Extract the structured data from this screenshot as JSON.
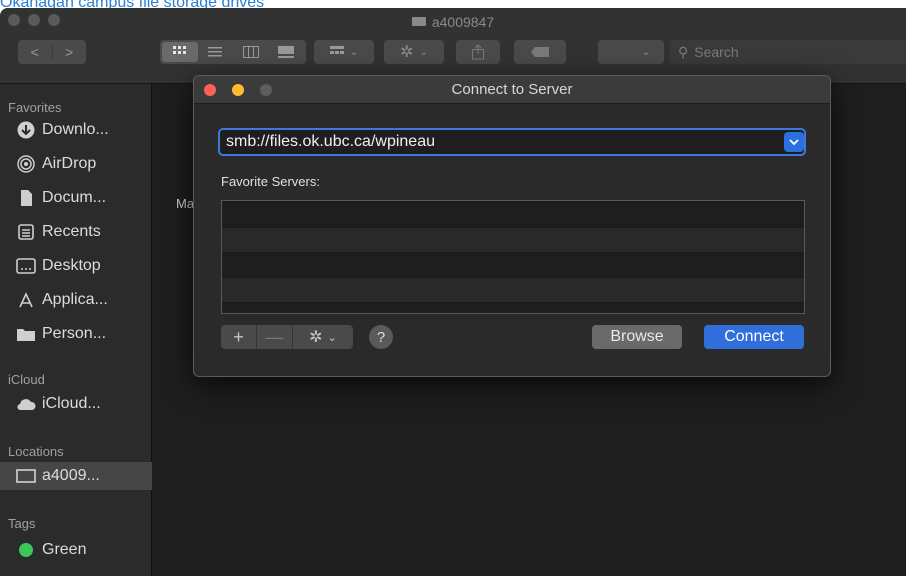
{
  "page_link": "Okanagan campus file storage drives",
  "window": {
    "title": "a4009847"
  },
  "toolbar": {
    "back": "<",
    "forward": ">",
    "search_placeholder": "Search"
  },
  "sidebar": {
    "sections": {
      "favorites": "Favorites",
      "icloud": "iCloud",
      "locations": "Locations",
      "tags": "Tags"
    },
    "favorites": [
      {
        "label": "Downlo...",
        "icon": "download-icon"
      },
      {
        "label": "AirDrop",
        "icon": "airdrop-icon"
      },
      {
        "label": "Docum...",
        "icon": "document-icon"
      },
      {
        "label": "Recents",
        "icon": "recents-icon"
      },
      {
        "label": "Desktop",
        "icon": "desktop-icon"
      },
      {
        "label": "Applica...",
        "icon": "applications-icon"
      },
      {
        "label": "Person...",
        "icon": "folder-icon"
      }
    ],
    "icloud": [
      {
        "label": "iCloud...",
        "icon": "cloud-icon"
      }
    ],
    "locations": [
      {
        "label": "a4009...",
        "icon": "computer-icon"
      }
    ],
    "tags": [
      {
        "label": "Green",
        "color": "#3cc65a"
      }
    ]
  },
  "content": {
    "peek_text": "Ma"
  },
  "dialog": {
    "title": "Connect to Server",
    "server_address": "smb://files.ok.ubc.ca/wpineau",
    "favorites_label": "Favorite Servers:",
    "add_label": "+",
    "remove_label": "—",
    "help_label": "?",
    "browse_label": "Browse",
    "connect_label": "Connect"
  },
  "colors": {
    "accent": "#2f6edb",
    "close": "#fe5f57",
    "minimize": "#febc2e"
  }
}
